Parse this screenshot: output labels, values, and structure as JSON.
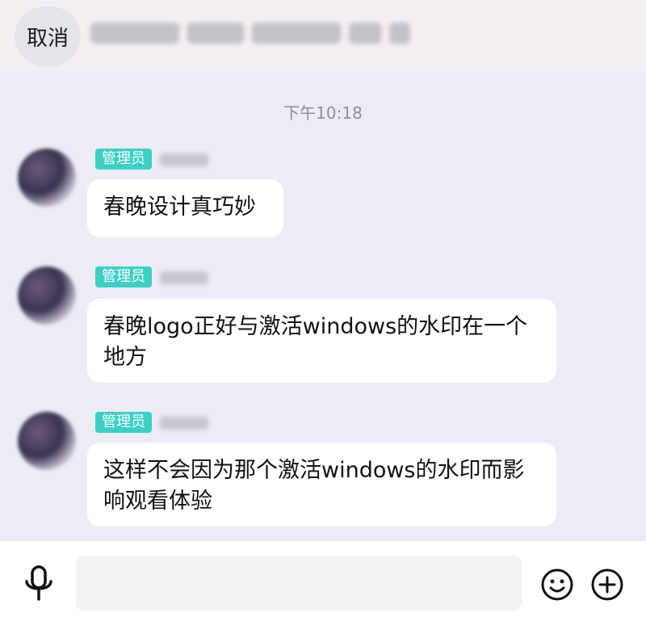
{
  "header": {
    "cancel_label": "取消",
    "blurred_title": "[blurred]"
  },
  "chat": {
    "timestamp": "下午10:18",
    "messages": [
      {
        "badge": "管理员",
        "text": "春晚设计真巧妙"
      },
      {
        "badge": "管理员",
        "text": "春晚logo正好与激活windows的水印在一个地方"
      },
      {
        "badge": "管理员",
        "text": "这样不会因为那个激活windows的水印而影响观看体验"
      }
    ]
  },
  "footer": {
    "mic_icon": "microphone-icon",
    "emoji_icon": "smiley-icon",
    "plus_icon": "plus-circle-icon",
    "input_value": ""
  },
  "colors": {
    "badge": "#3bd0c6",
    "chat_background": "#ececf4",
    "header_background": "#f2eef2",
    "bubble": "#ffffff"
  }
}
